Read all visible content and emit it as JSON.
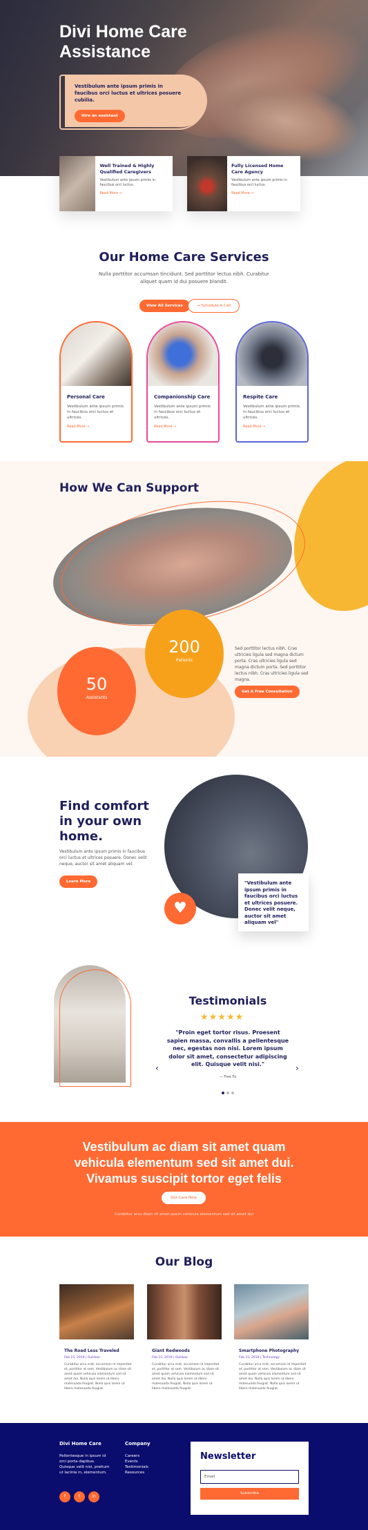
{
  "hero": {
    "title": "Divi Home Care Assistance",
    "text": "Vestibulum ante ipsum primis in faucibus orci luctus et ultrices posuere cubilia.",
    "button": "Hire an assistant"
  },
  "features": [
    {
      "title": "Well Trained & Highly Qualified Caregivers",
      "text": "Vestibulum ante ipsum primis in faucibus orci luctus.",
      "link": "Read More →"
    },
    {
      "title": "Fully Licensed Home Care Agency",
      "text": "Vestibulum ante ipsum primis in faucibus orci luctus.",
      "link": "Read More →"
    }
  ],
  "services": {
    "title": "Our Home Care Services",
    "subtitle": "Nulla porttitor accumsan tincidunt. Sed porttitor lectus nibh. Curabitur aliquet quam id dui posuere blandit.",
    "btn_all": "View All Services",
    "btn_call": "→ Schedule A Call",
    "items": [
      {
        "title": "Personal Care",
        "text": "Vestibulum ante ipsum primis in faucibus orci luctus et ultrices.",
        "link": "Read More →"
      },
      {
        "title": "Companionship Care",
        "text": "Vestibulum ante ipsum primis in faucibus orci luctus et ultrices.",
        "link": "Read More →"
      },
      {
        "title": "Respite Care",
        "text": "Vestibulum ante ipsum primis in faucibus orci luctus et ultrices.",
        "link": "Read More →"
      }
    ]
  },
  "support": {
    "title": "How We Can Support",
    "stat1": {
      "num": "200",
      "label": "Patients"
    },
    "stat2": {
      "num": "50",
      "label": "Assistants"
    },
    "text": "Sed porttitor lectus nibh. Cras ultricies ligula sed magna dictum porta. Cras ultricies ligula sed magna dictum porta. Sed porttitor lectus nibh. Cras ultricies ligula sed magna.",
    "button": "Get A Free Consultation"
  },
  "comfort": {
    "title": "Find comfort in your own home.",
    "text": "Vestibulum ante ipsum primis in faucibus orci luctus et ultrices posuere. Donec velit neque, auctor sit amet aliquam vel.",
    "button": "Learn More",
    "quote": "\"Vestibulum ante ipsum primis in faucibus orci luctus et ultrices posuere. Donec velit neque, auctor sit amet aliquam vel\""
  },
  "testimonials": {
    "title": "Testimonials",
    "stars": "★★★★★",
    "quote": "\"Proin eget tortor risus. Proesent sapien massa, convallis a pellentesque nec, egestas non nisi. Lorem ipsum dolor sit amet, consectetur adipiscing elit. Quisque velit nisi.\"",
    "author": "— Free Fo",
    "prev": "‹",
    "next": "›"
  },
  "cta": {
    "title": "Vestibulum ac diam sit amet quam vehicula elementum sed sit amet dui. Vivamus suscipit tortor eget felis",
    "button": "Get Care Now",
    "sub": "Curabitur arcu diam sit amet quam vehicula elementum sed sit amet dui"
  },
  "blog": {
    "title": "Our Blog",
    "posts": [
      {
        "title": "The Road Less Traveled",
        "meta": "Feb 15, 2019 | Outdoor",
        "text": "Curabitur arcu erat, accumsan id imperdiet et, porttitor at sem. Vestibulum ac diam sit amet quam vehicula elementum sed sit amet dui. Nulla quis lorem ut libero malesuada feugiat. Nulla quis lorem ut libero malesuada feugiat."
      },
      {
        "title": "Giant Redwoods",
        "meta": "Feb 15, 2019 | Outdoor",
        "text": "Curabitur arcu erat, accumsan id imperdiet et, porttitor at sem. Vestibulum ac diam sit amet quam vehicula elementum sed sit amet dui. Nulla quis lorem ut libero malesuada feugiat. Nulla quis lorem ut libero malesuada feugiat."
      },
      {
        "title": "Smartphone Photography",
        "meta": "Feb 15, 2019 | Technology",
        "text": "Curabitur arcu erat, accumsan id imperdiet et, porttitor at sem. Vestibulum ac diam sit amet quam vehicula elementum sed sit amet dui. Nulla quis lorem ut libero malesuada feugiat. Nulla quis lorem ut libero malesuada feugiat."
      }
    ]
  },
  "footer": {
    "brand": "Divi Home Care",
    "brand_text": "Pellentesque in ipsum id orci porta dapibus. Quisque velit nisi, pretium ut lacinia in, elementum.",
    "company": "Company",
    "links": [
      "Careers",
      "Events",
      "Testimonials",
      "Resources"
    ],
    "social": [
      "f",
      "t",
      "in"
    ],
    "newsletter": {
      "title": "Newsletter",
      "placeholder": "Email",
      "button": "Subscribe"
    }
  },
  "colors": {
    "accent": "#ff6a33",
    "navy": "#0a0c6e",
    "heading": "#1f1f5c",
    "yellow": "#f7b733",
    "peach": "#f4c7a8"
  }
}
